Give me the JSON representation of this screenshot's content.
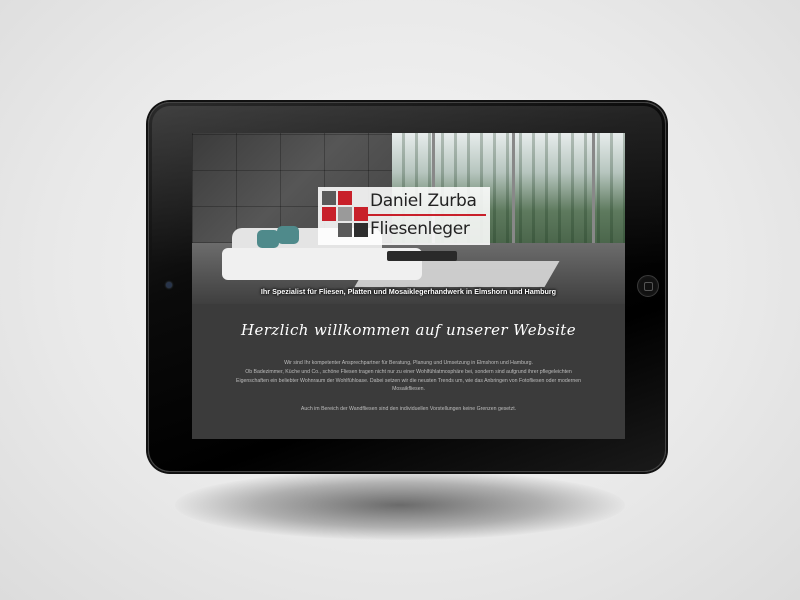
{
  "site": {
    "logo": {
      "name": "Daniel Zurba",
      "subtitle": "Fliesenleger",
      "tile_colors": [
        "#5a5a5a",
        "#c8202a",
        "#9a9a9a",
        "#2e2e2e"
      ]
    },
    "tagline": "Ihr Spezialist für Fliesen, Platten und Mosaiklegerhandwerk in Elmshorn und Hamburg",
    "welcome_heading": "Herzlich willkommen auf unserer Website",
    "paragraphs": [
      "Wir sind Ihr kompetenter Ansprechpartner für Beratung, Planung und Umsetzung in Elmshorn und Hamburg.",
      "Ob Badezimmer, Küche und Co., schöne Fliesen tragen nicht nur zu einer Wohlfühlatmosphäre bei, sondern sind aufgrund ihrer pflegeleichten Eigenschaften ein beliebter Wohnraum der Wohlfühloase. Dabei setzen wir die neusten Trends um, wie das Anbringen von Fotofliesen oder modernen Mosaikfliesen.",
      "Auch im Bereich der Wandfliesen sind den individuellen Vorstellungen keine Grenzen gesetzt."
    ],
    "colors": {
      "accent": "#c8202a",
      "content_bg": "#3b3b3b"
    }
  },
  "device": {
    "type": "tablet",
    "icons": [
      "camera-icon",
      "home-button-icon"
    ]
  }
}
